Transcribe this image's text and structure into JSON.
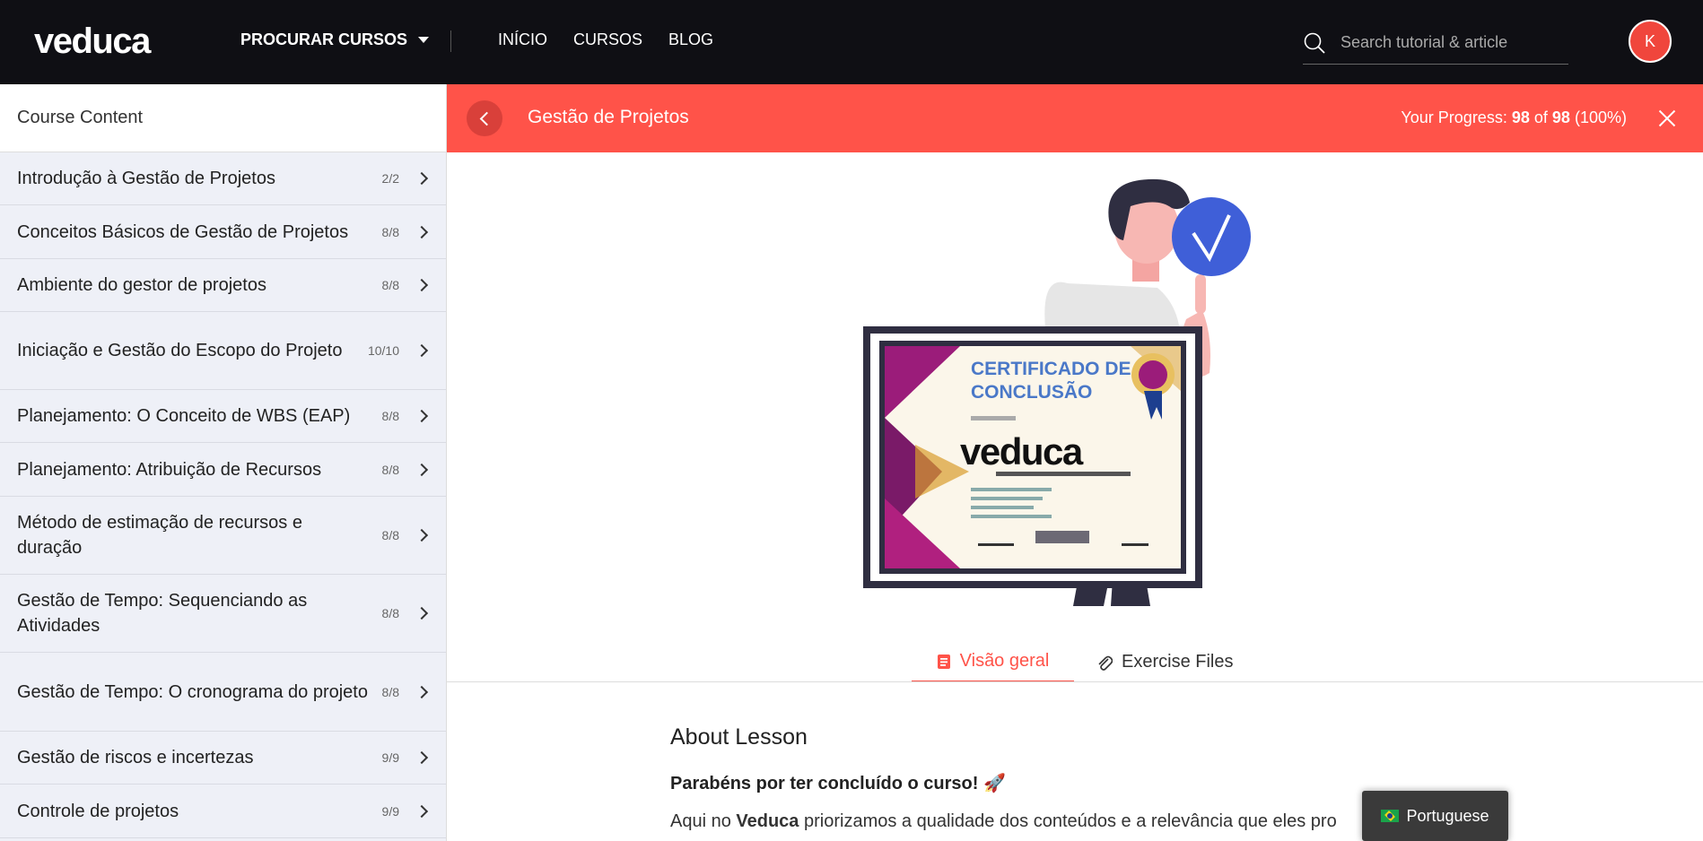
{
  "navbar": {
    "logo_text": "veduca",
    "browse_label": "PROCURAR CURSOS",
    "links": [
      "INÍCIO",
      "CURSOS",
      "BLOG"
    ],
    "search_placeholder": "Search tutorial & article",
    "avatar_initial": "K"
  },
  "sidebar": {
    "title": "Course Content",
    "topics": [
      {
        "title": "Introdução à Gestão de Projetos",
        "count": "2/2"
      },
      {
        "title": "Conceitos Básicos de Gestão de Projetos",
        "count": "8/8"
      },
      {
        "title": "Ambiente do gestor de projetos",
        "count": "8/8"
      },
      {
        "title": "Iniciação e Gestão do Escopo do Projeto",
        "count": "10/10"
      },
      {
        "title": "Planejamento: O Conceito de WBS (EAP)",
        "count": "8/8"
      },
      {
        "title": "Planejamento: Atribuição de Recursos",
        "count": "8/8"
      },
      {
        "title": "Método de estimação de recursos e duração",
        "count": "8/8"
      },
      {
        "title": "Gestão de Tempo: Sequenciando as Atividades",
        "count": "8/8"
      },
      {
        "title": "Gestão de Tempo: O cronograma do projeto",
        "count": "8/8"
      },
      {
        "title": "Gestão de riscos e incertezas",
        "count": "9/9"
      },
      {
        "title": "Controle de projetos",
        "count": "9/9"
      }
    ]
  },
  "course_header": {
    "title": "Gestão de Projetos",
    "progress_label": "Your Progress:",
    "progress_done": "98",
    "progress_of": "of",
    "progress_total": "98",
    "progress_percent": "(100%)"
  },
  "certificate": {
    "heading_line1": "CERTIFICADO DE",
    "heading_line2": "CONCLUSÃO",
    "logo_text": "veduca"
  },
  "tabs": {
    "overview": "Visão geral",
    "files": "Exercise Files"
  },
  "lesson": {
    "heading": "About Lesson",
    "congrats": "Parabéns por ter concluído o curso! 🚀",
    "para_prefix": "Aqui no ",
    "para_brand": "Veduca",
    "para_rest": " priorizamos a qualidade dos conteúdos e a relevância que eles pro"
  },
  "language_button": "Portuguese",
  "colors": {
    "brand_red": "#ff5349",
    "navbar_bg": "#0f0f14",
    "sidebar_bg": "#eef0f7",
    "check_blue": "#3f5fd8"
  }
}
